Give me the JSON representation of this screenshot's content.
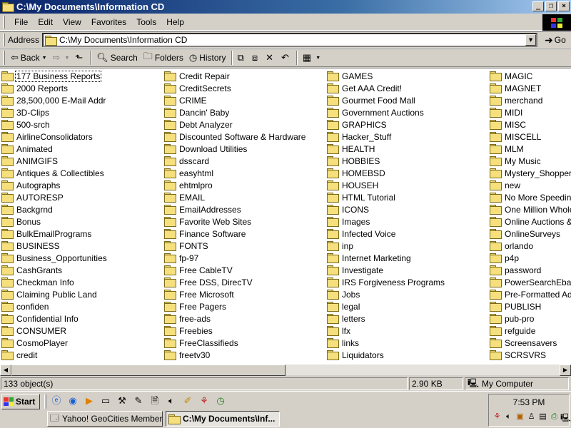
{
  "window": {
    "title": "C:\\My Documents\\Information CD",
    "minimize": "_",
    "restore": "❐",
    "close": "×"
  },
  "menu": [
    "File",
    "Edit",
    "View",
    "Favorites",
    "Tools",
    "Help"
  ],
  "address": {
    "label": "Address",
    "value": "C:\\My Documents\\Information CD",
    "go": "Go"
  },
  "toolbar": {
    "back": "Back",
    "search": "Search",
    "folders": "Folders",
    "history": "History"
  },
  "columns": [
    [
      "177 Business Reports",
      "2000 Reports",
      "28,500,000 E-Mail Addr",
      "3D-Clips",
      "500-srch",
      "AirlineConsolidators",
      "Animated",
      "ANIMGIFS",
      "Antiques & Collectibles",
      "Autographs",
      "AUTORESP",
      "Backgrnd",
      "Bonus",
      "BulkEmailPrograms",
      "BUSINESS",
      "Business_Opportunities",
      "CashGrants",
      "Checkman Info",
      "Claiming Public Land",
      "confiden",
      "Confidential Info",
      "CONSUMER",
      "CosmoPlayer",
      "credit"
    ],
    [
      "Credit Repair",
      "CreditSecrets",
      "CRIME",
      "Dancin' Baby",
      "Debt Analyzer",
      "Discounted Software & Hardware",
      "Download Utilities",
      "dsscard",
      "easyhtml",
      "ehtmlpro",
      "EMAIL",
      "EmailAddresses",
      "Favorite Web Sites",
      "Finance Software",
      "FONTS",
      "fp-97",
      "Free CableTV",
      "Free DSS, DirecTV",
      "Free Microsoft",
      "Free Pagers",
      "free-ads",
      "Freebies",
      "FreeClassifieds",
      "freetv30"
    ],
    [
      "GAMES",
      "Get AAA Credit!",
      "Gourmet Food Mall",
      "Government Auctions",
      "GRAPHICS",
      "Hacker_Stuff",
      "HEALTH",
      "HOBBIES",
      "HOMEBSD",
      "HOUSEH",
      "HTML Tutorial",
      "ICONS",
      "Images",
      "Infected Voice",
      "inp",
      "Internet Marketing",
      "Investigate",
      "IRS Forgiveness Programs",
      "Jobs",
      "legal",
      "letters",
      "lfx",
      "links",
      "Liquidators"
    ],
    [
      "MAGIC",
      "MAGNET",
      "merchand",
      "MIDI",
      "MISC",
      "MISCELL",
      "MLM",
      "My Music",
      "Mystery_Shopper",
      "new",
      "No More Speeding T",
      "One Million Wholesa",
      "Online Auctions & C",
      "OnlineSurveys",
      "orlando",
      "p4p",
      "password",
      "PowerSearchEbay",
      "Pre-Formatted Ads",
      "PUBLISH",
      "pub-pro",
      "refguide",
      "Screensavers",
      "SCRSVRS"
    ]
  ],
  "status": {
    "objects": "133 object(s)",
    "size": "2.90 KB",
    "zone": "My Computer"
  },
  "taskbar": {
    "start": "Start",
    "tasks": [
      "Yahoo! GeoCities Member ...",
      "C:\\My Documents\\Inf..."
    ],
    "clock": "7:53 PM"
  }
}
